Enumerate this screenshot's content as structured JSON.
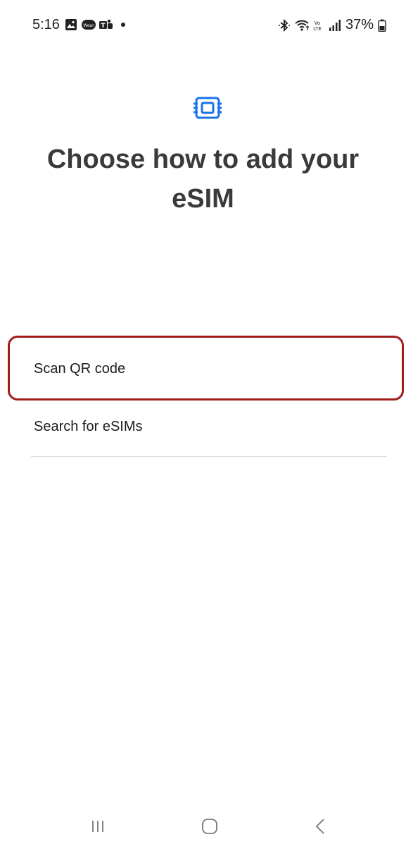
{
  "status_bar": {
    "time": "5:16",
    "left_icons": [
      "gallery-icon",
      "wear-icon",
      "teams-icon"
    ],
    "right_icons": [
      "bluetooth-icon",
      "wifi-icon",
      "volte-icon",
      "signal-icon",
      "battery-icon"
    ],
    "battery": "37%"
  },
  "header": {
    "title": "Choose how to add your eSIM",
    "icon": "esim-card-icon",
    "icon_color": "#1a73e8"
  },
  "options": [
    {
      "label": "Scan QR code",
      "highlighted": true
    },
    {
      "label": "Search for eSIMs",
      "highlighted": false
    }
  ],
  "highlight_color": "#a31c1c",
  "nav_bar": {
    "items": [
      "recents-icon",
      "home-icon",
      "back-icon"
    ]
  }
}
